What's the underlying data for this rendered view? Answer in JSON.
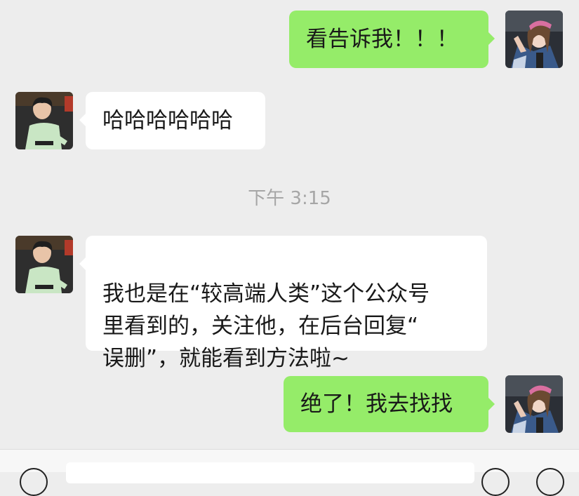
{
  "messages": [
    {
      "id": "m1",
      "side": "out",
      "text": "看告诉我！！！"
    },
    {
      "id": "m2",
      "side": "in",
      "text": "哈哈哈哈哈哈"
    },
    {
      "id": "m3",
      "side": "in",
      "text": "我也是在“较高端人类”这个公众号\n里看到的，关注他，在后台回复“\n误删”，就能看到方法啦~"
    },
    {
      "id": "m4",
      "side": "out",
      "text": "绝了！我去找找"
    }
  ],
  "timestamp": "下午 3:15",
  "colors": {
    "background": "#ededed",
    "outgoing_bubble": "#95ec69",
    "incoming_bubble": "#ffffff",
    "timestamp_text": "#a6a6a6"
  },
  "icons": [
    "user-avatar-girl-icon",
    "contact-avatar-boy-icon",
    "voice-icon",
    "emoji-icon",
    "add-icon"
  ]
}
